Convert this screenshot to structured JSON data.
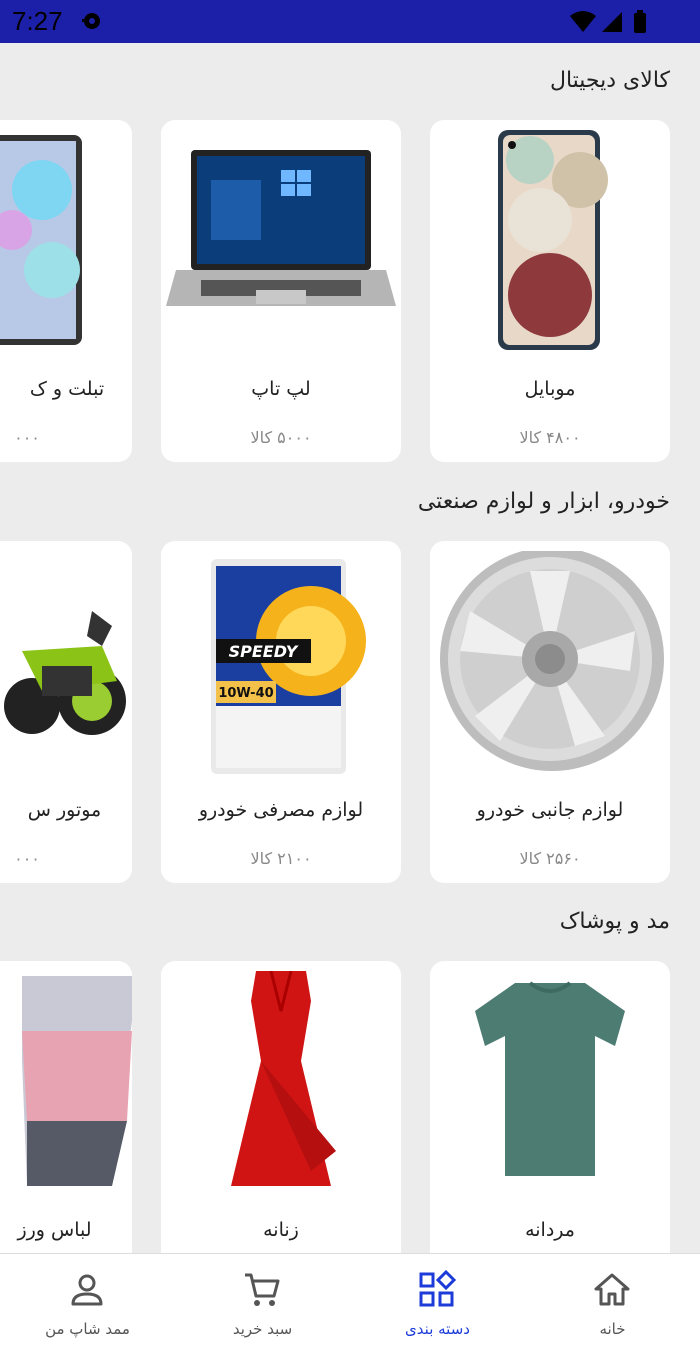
{
  "status_bar": {
    "time": "7:27",
    "bg_color": "#1c1fa8",
    "icons": [
      "notification-icon",
      "wifi-icon",
      "signal-icon",
      "battery-icon"
    ]
  },
  "sections": [
    {
      "title": "کالای دیجیتال",
      "items": [
        {
          "label": "موبایل",
          "count": "۴۸۰۰ کالا",
          "icon": "mobile-phone-image"
        },
        {
          "label": "لپ تاپ",
          "count": "۵۰۰۰ کالا",
          "icon": "laptop-image"
        },
        {
          "label": "تبلت و ک",
          "count": "۰۰۰",
          "icon": "tablet-image"
        }
      ]
    },
    {
      "title": "خودرو، ابزار و لوازم صنعتی",
      "items": [
        {
          "label": "لوازم جانبی خودرو",
          "count": "۲۵۶۰ کالا",
          "icon": "car-wheel-image"
        },
        {
          "label": "لوازم مصرفی خودرو",
          "count": "۲۱۰۰ کالا",
          "icon": "motor-oil-image"
        },
        {
          "label": "موتور س",
          "count": "۰۰۰",
          "icon": "motorcycle-image"
        }
      ]
    },
    {
      "title": "مد و پوشاک",
      "items": [
        {
          "label": "مردانه",
          "count": "",
          "icon": "tshirt-image"
        },
        {
          "label": "زنانه",
          "count": "",
          "icon": "dress-image"
        },
        {
          "label": "لباس ورز",
          "count": "",
          "icon": "leggings-image"
        }
      ]
    }
  ],
  "bottom_nav": {
    "active_color": "#1d3bd8",
    "items": [
      {
        "label": "خانه",
        "icon": "home-icon"
      },
      {
        "label": "دسته بندی",
        "icon": "category-icon",
        "active": true
      },
      {
        "label": "سبد خرید",
        "icon": "cart-icon"
      },
      {
        "label": "ممد شاپ من",
        "icon": "profile-icon"
      }
    ]
  }
}
